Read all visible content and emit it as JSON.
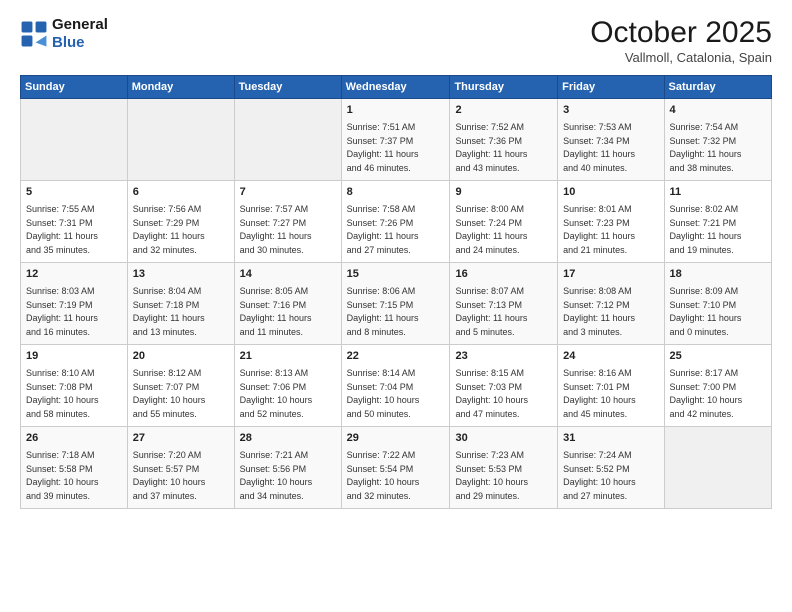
{
  "logo": {
    "line1": "General",
    "line2": "Blue"
  },
  "header": {
    "month": "October 2025",
    "location": "Vallmoll, Catalonia, Spain"
  },
  "weekdays": [
    "Sunday",
    "Monday",
    "Tuesday",
    "Wednesday",
    "Thursday",
    "Friday",
    "Saturday"
  ],
  "rows": [
    [
      {
        "day": "",
        "info": ""
      },
      {
        "day": "",
        "info": ""
      },
      {
        "day": "",
        "info": ""
      },
      {
        "day": "1",
        "info": "Sunrise: 7:51 AM\nSunset: 7:37 PM\nDaylight: 11 hours\nand 46 minutes."
      },
      {
        "day": "2",
        "info": "Sunrise: 7:52 AM\nSunset: 7:36 PM\nDaylight: 11 hours\nand 43 minutes."
      },
      {
        "day": "3",
        "info": "Sunrise: 7:53 AM\nSunset: 7:34 PM\nDaylight: 11 hours\nand 40 minutes."
      },
      {
        "day": "4",
        "info": "Sunrise: 7:54 AM\nSunset: 7:32 PM\nDaylight: 11 hours\nand 38 minutes."
      }
    ],
    [
      {
        "day": "5",
        "info": "Sunrise: 7:55 AM\nSunset: 7:31 PM\nDaylight: 11 hours\nand 35 minutes."
      },
      {
        "day": "6",
        "info": "Sunrise: 7:56 AM\nSunset: 7:29 PM\nDaylight: 11 hours\nand 32 minutes."
      },
      {
        "day": "7",
        "info": "Sunrise: 7:57 AM\nSunset: 7:27 PM\nDaylight: 11 hours\nand 30 minutes."
      },
      {
        "day": "8",
        "info": "Sunrise: 7:58 AM\nSunset: 7:26 PM\nDaylight: 11 hours\nand 27 minutes."
      },
      {
        "day": "9",
        "info": "Sunrise: 8:00 AM\nSunset: 7:24 PM\nDaylight: 11 hours\nand 24 minutes."
      },
      {
        "day": "10",
        "info": "Sunrise: 8:01 AM\nSunset: 7:23 PM\nDaylight: 11 hours\nand 21 minutes."
      },
      {
        "day": "11",
        "info": "Sunrise: 8:02 AM\nSunset: 7:21 PM\nDaylight: 11 hours\nand 19 minutes."
      }
    ],
    [
      {
        "day": "12",
        "info": "Sunrise: 8:03 AM\nSunset: 7:19 PM\nDaylight: 11 hours\nand 16 minutes."
      },
      {
        "day": "13",
        "info": "Sunrise: 8:04 AM\nSunset: 7:18 PM\nDaylight: 11 hours\nand 13 minutes."
      },
      {
        "day": "14",
        "info": "Sunrise: 8:05 AM\nSunset: 7:16 PM\nDaylight: 11 hours\nand 11 minutes."
      },
      {
        "day": "15",
        "info": "Sunrise: 8:06 AM\nSunset: 7:15 PM\nDaylight: 11 hours\nand 8 minutes."
      },
      {
        "day": "16",
        "info": "Sunrise: 8:07 AM\nSunset: 7:13 PM\nDaylight: 11 hours\nand 5 minutes."
      },
      {
        "day": "17",
        "info": "Sunrise: 8:08 AM\nSunset: 7:12 PM\nDaylight: 11 hours\nand 3 minutes."
      },
      {
        "day": "18",
        "info": "Sunrise: 8:09 AM\nSunset: 7:10 PM\nDaylight: 11 hours\nand 0 minutes."
      }
    ],
    [
      {
        "day": "19",
        "info": "Sunrise: 8:10 AM\nSunset: 7:08 PM\nDaylight: 10 hours\nand 58 minutes."
      },
      {
        "day": "20",
        "info": "Sunrise: 8:12 AM\nSunset: 7:07 PM\nDaylight: 10 hours\nand 55 minutes."
      },
      {
        "day": "21",
        "info": "Sunrise: 8:13 AM\nSunset: 7:06 PM\nDaylight: 10 hours\nand 52 minutes."
      },
      {
        "day": "22",
        "info": "Sunrise: 8:14 AM\nSunset: 7:04 PM\nDaylight: 10 hours\nand 50 minutes."
      },
      {
        "day": "23",
        "info": "Sunrise: 8:15 AM\nSunset: 7:03 PM\nDaylight: 10 hours\nand 47 minutes."
      },
      {
        "day": "24",
        "info": "Sunrise: 8:16 AM\nSunset: 7:01 PM\nDaylight: 10 hours\nand 45 minutes."
      },
      {
        "day": "25",
        "info": "Sunrise: 8:17 AM\nSunset: 7:00 PM\nDaylight: 10 hours\nand 42 minutes."
      }
    ],
    [
      {
        "day": "26",
        "info": "Sunrise: 7:18 AM\nSunset: 5:58 PM\nDaylight: 10 hours\nand 39 minutes."
      },
      {
        "day": "27",
        "info": "Sunrise: 7:20 AM\nSunset: 5:57 PM\nDaylight: 10 hours\nand 37 minutes."
      },
      {
        "day": "28",
        "info": "Sunrise: 7:21 AM\nSunset: 5:56 PM\nDaylight: 10 hours\nand 34 minutes."
      },
      {
        "day": "29",
        "info": "Sunrise: 7:22 AM\nSunset: 5:54 PM\nDaylight: 10 hours\nand 32 minutes."
      },
      {
        "day": "30",
        "info": "Sunrise: 7:23 AM\nSunset: 5:53 PM\nDaylight: 10 hours\nand 29 minutes."
      },
      {
        "day": "31",
        "info": "Sunrise: 7:24 AM\nSunset: 5:52 PM\nDaylight: 10 hours\nand 27 minutes."
      },
      {
        "day": "",
        "info": ""
      }
    ]
  ]
}
